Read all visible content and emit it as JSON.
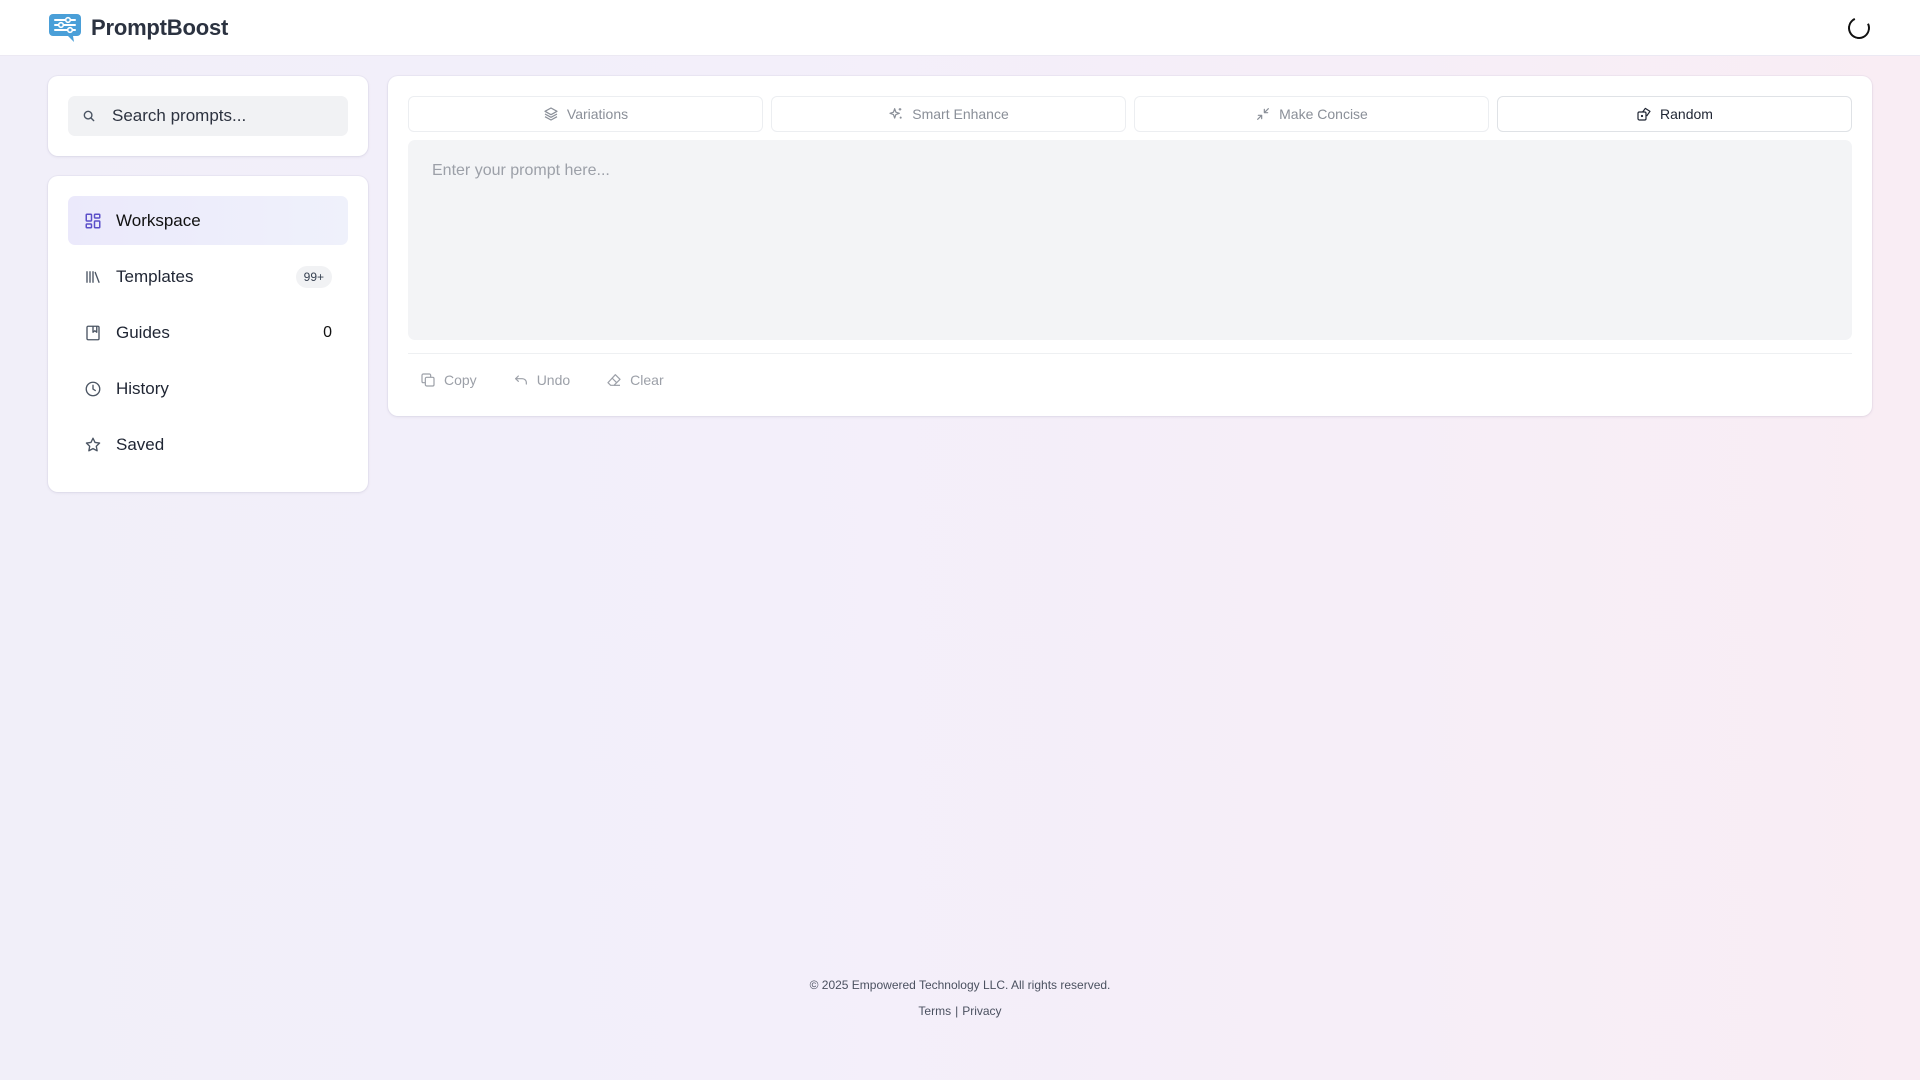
{
  "brand": {
    "name": "PromptBoost",
    "accent": "#4a9fd8"
  },
  "search": {
    "placeholder": "Search prompts..."
  },
  "sidebar": {
    "items": [
      {
        "label": "Workspace",
        "icon": "layout-grid-icon",
        "active": true
      },
      {
        "label": "Templates",
        "icon": "library-icon",
        "badge": "99+"
      },
      {
        "label": "Guides",
        "icon": "bookmark-icon",
        "count": "0"
      },
      {
        "label": "History",
        "icon": "clock-icon"
      },
      {
        "label": "Saved",
        "icon": "star-icon"
      }
    ]
  },
  "toolbar": {
    "variations": "Variations",
    "smart_enhance": "Smart Enhance",
    "make_concise": "Make Concise",
    "random": "Random"
  },
  "editor": {
    "placeholder": "Enter your prompt here..."
  },
  "actions": {
    "copy": "Copy",
    "undo": "Undo",
    "clear": "Clear"
  },
  "footer": {
    "copyright": "© 2025 Empowered Technology LLC. All rights reserved.",
    "terms": "Terms",
    "separator": "|",
    "privacy": "Privacy"
  }
}
